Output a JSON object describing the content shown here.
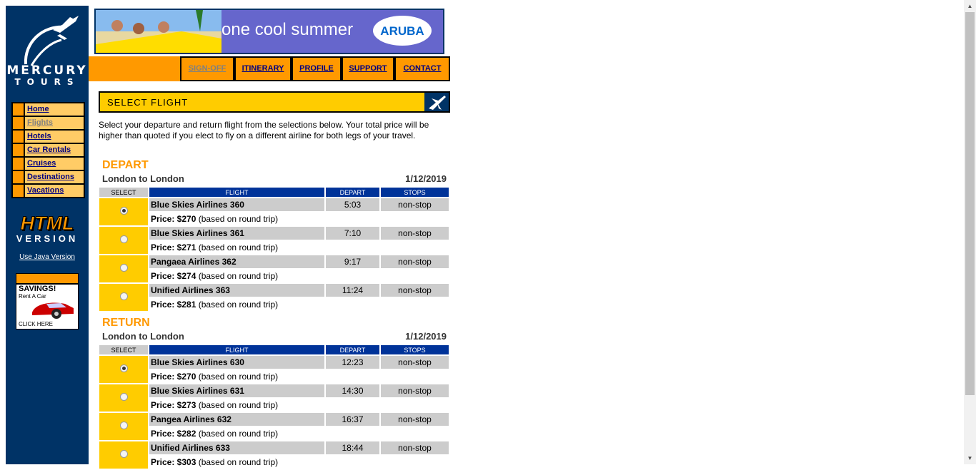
{
  "sidebar": {
    "logo_line1": "MERCURY",
    "logo_line2": "TOURS",
    "nav": [
      {
        "label": "Home"
      },
      {
        "label": "Flights"
      },
      {
        "label": "Hotels"
      },
      {
        "label": "Car Rentals"
      },
      {
        "label": "Cruises"
      },
      {
        "label": "Destinations"
      },
      {
        "label": "Vacations"
      }
    ],
    "html_badge": "HTML",
    "version_label": "VERSION",
    "java_link": "Use Java Version",
    "ad": {
      "line1": "SAVINGS!",
      "line2": "Rent A Car",
      "line3": "CLICK HERE"
    }
  },
  "banner": {
    "text": "one cool summer",
    "brand": "ARUBA"
  },
  "topnav": [
    "SIGN-OFF",
    "ITINERARY",
    "PROFILE",
    "SUPPORT",
    "CONTACT"
  ],
  "page": {
    "title": "SELECT FLIGHT",
    "intro": "Select your departure and return flight from the selections below. Your total price will be higher than quoted if you elect to fly on a different airline for both legs of your travel."
  },
  "columns": {
    "select": "SELECT",
    "flight": "FLIGHT",
    "depart": "DEPART",
    "stops": "STOPS"
  },
  "depart": {
    "heading": "DEPART",
    "route": "London to London",
    "date": "1/12/2019",
    "flights": [
      {
        "name": "Blue Skies Airlines 360",
        "time": "5:03",
        "stops": "non-stop",
        "price": "Price: $270",
        "note": "(based on round trip)",
        "selected": true
      },
      {
        "name": "Blue Skies Airlines 361",
        "time": "7:10",
        "stops": "non-stop",
        "price": "Price: $271",
        "note": "(based on round trip)",
        "selected": false
      },
      {
        "name": "Pangaea Airlines 362",
        "time": "9:17",
        "stops": "non-stop",
        "price": "Price: $274",
        "note": "(based on round trip)",
        "selected": false
      },
      {
        "name": "Unified Airlines 363",
        "time": "11:24",
        "stops": "non-stop",
        "price": "Price: $281",
        "note": "(based on round trip)",
        "selected": false
      }
    ]
  },
  "return": {
    "heading": "RETURN",
    "route": "London to London",
    "date": "1/12/2019",
    "flights": [
      {
        "name": "Blue Skies Airlines 630",
        "time": "12:23",
        "stops": "non-stop",
        "price": "Price: $270",
        "note": "(based on round trip)",
        "selected": true
      },
      {
        "name": "Blue Skies Airlines 631",
        "time": "14:30",
        "stops": "non-stop",
        "price": "Price: $273",
        "note": "(based on round trip)",
        "selected": false
      },
      {
        "name": "Pangea Airlines 632",
        "time": "16:37",
        "stops": "non-stop",
        "price": "Price: $282",
        "note": "(based on round trip)",
        "selected": false
      },
      {
        "name": "Unified Airlines 633",
        "time": "18:44",
        "stops": "non-stop",
        "price": "Price: $303",
        "note": "(based on round trip)",
        "selected": false
      }
    ]
  }
}
